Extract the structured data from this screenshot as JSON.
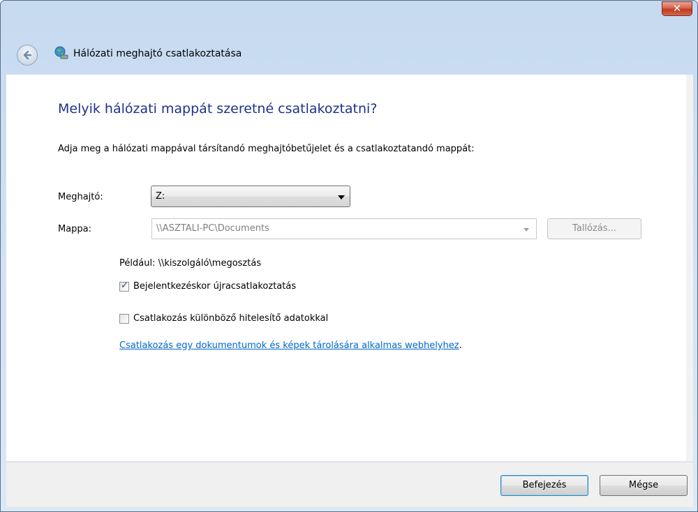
{
  "window": {
    "title": "Hálózati meghajtó csatlakoztatása",
    "close_glyph": "✕"
  },
  "main": {
    "heading": "Melyik hálózati mappát szeretné csatlakoztatni?",
    "description": "Adja meg a hálózati mappával társítandó meghajtóbetűjelet és a csatlakoztatandó mappát:"
  },
  "drive": {
    "label": "Meghajtó:",
    "value": "Z:"
  },
  "folder": {
    "label": "Mappa:",
    "value": "\\\\ASZTALI-PC\\Documents",
    "browse_label": "Tallózás..."
  },
  "example_text": "Például: \\\\kiszolgáló\\megosztás",
  "options": [
    {
      "label": "Bejelentkezéskor újracsatlakoztatás",
      "checked": true
    },
    {
      "label": "Csatlakozás különböző hitelesítő adatokkal",
      "checked": false
    }
  ],
  "link": {
    "text": "Csatlakozás egy dokumentumok és képek tárolására alkalmas webhelyhez",
    "suffix": "."
  },
  "footer": {
    "finish_label": "Befejezés",
    "cancel_label": "Mégse"
  },
  "icons": {
    "back": "back-arrow-icon",
    "network_drive": "network-drive-icon",
    "checkmark": "✓"
  }
}
